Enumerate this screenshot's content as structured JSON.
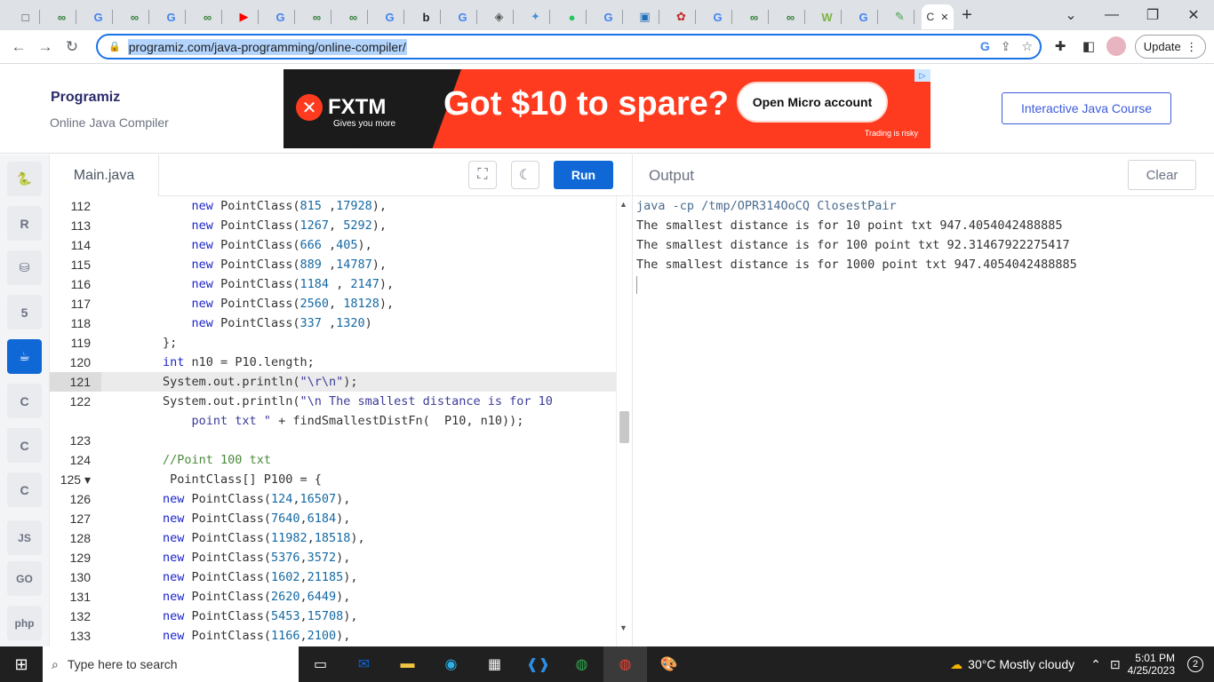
{
  "browser": {
    "tabs": [
      {
        "icon": "□",
        "color": "#444"
      },
      {
        "icon": "∞",
        "color": "#2e7d32"
      },
      {
        "icon": "G",
        "color": "#4285f4"
      },
      {
        "icon": "∞",
        "color": "#2e7d32"
      },
      {
        "icon": "G",
        "color": "#4285f4"
      },
      {
        "icon": "∞",
        "color": "#2e7d32"
      },
      {
        "icon": "▶",
        "color": "#ff0000"
      },
      {
        "icon": "G",
        "color": "#4285f4"
      },
      {
        "icon": "∞",
        "color": "#2e7d32"
      },
      {
        "icon": "∞",
        "color": "#2e7d32"
      },
      {
        "icon": "G",
        "color": "#4285f4"
      },
      {
        "icon": "b",
        "color": "#222"
      },
      {
        "icon": "G",
        "color": "#4285f4"
      },
      {
        "icon": "◈",
        "color": "#555"
      },
      {
        "icon": "✦",
        "color": "#4a90d9"
      },
      {
        "icon": "●",
        "color": "#22c55e"
      },
      {
        "icon": "G",
        "color": "#4285f4"
      },
      {
        "icon": "▣",
        "color": "#1e6fb8"
      },
      {
        "icon": "✿",
        "color": "#c62828"
      },
      {
        "icon": "G",
        "color": "#4285f4"
      },
      {
        "icon": "∞",
        "color": "#2e7d32"
      },
      {
        "icon": "∞",
        "color": "#2e7d32"
      },
      {
        "icon": "W",
        "color": "#7cb342"
      },
      {
        "icon": "G",
        "color": "#4285f4"
      },
      {
        "icon": "✎",
        "color": "#43a047"
      }
    ],
    "active_tab_letter": "C",
    "url": "programiz.com/java-programming/online-compiler/",
    "update_label": "Update"
  },
  "site": {
    "logo": "Programiz",
    "subtitle": "Online Java Compiler",
    "course_button": "Interactive Java Course"
  },
  "ad": {
    "brand": "FXTM",
    "tagline": "Gives you more",
    "headline": "Got $10 to spare?",
    "button": "Open Micro account",
    "note": "Trading is risky"
  },
  "sidebar": {
    "items": [
      "py",
      "R",
      "db",
      "5",
      "java",
      "C",
      "C++",
      "C#",
      "JS",
      "GO",
      "php"
    ]
  },
  "editor": {
    "file_tab": "Main.java",
    "run_label": "Run",
    "lines": [
      {
        "n": "112",
        "code": [
          [
            "",
            "            "
          ],
          [
            "kw",
            "new"
          ],
          [
            "",
            " PointClass("
          ],
          [
            "num",
            "815"
          ],
          [
            "",
            " ,"
          ],
          [
            "num",
            "17928"
          ],
          [
            "",
            "),"
          ]
        ]
      },
      {
        "n": "113",
        "code": [
          [
            "",
            "            "
          ],
          [
            "kw",
            "new"
          ],
          [
            "",
            " PointClass("
          ],
          [
            "num",
            "1267"
          ],
          [
            "",
            ", "
          ],
          [
            "num",
            "5292"
          ],
          [
            "",
            "),"
          ]
        ]
      },
      {
        "n": "114",
        "code": [
          [
            "",
            "            "
          ],
          [
            "kw",
            "new"
          ],
          [
            "",
            " PointClass("
          ],
          [
            "num",
            "666"
          ],
          [
            "",
            " ,"
          ],
          [
            "num",
            "405"
          ],
          [
            "",
            "),"
          ]
        ]
      },
      {
        "n": "115",
        "code": [
          [
            "",
            "            "
          ],
          [
            "kw",
            "new"
          ],
          [
            "",
            " PointClass("
          ],
          [
            "num",
            "889"
          ],
          [
            "",
            " ,"
          ],
          [
            "num",
            "14787"
          ],
          [
            "",
            "),"
          ]
        ]
      },
      {
        "n": "116",
        "code": [
          [
            "",
            "            "
          ],
          [
            "kw",
            "new"
          ],
          [
            "",
            " PointClass("
          ],
          [
            "num",
            "1184"
          ],
          [
            "",
            " , "
          ],
          [
            "num",
            "2147"
          ],
          [
            "",
            "),"
          ]
        ]
      },
      {
        "n": "117",
        "code": [
          [
            "",
            "            "
          ],
          [
            "kw",
            "new"
          ],
          [
            "",
            " PointClass("
          ],
          [
            "num",
            "2560"
          ],
          [
            "",
            ", "
          ],
          [
            "num",
            "18128"
          ],
          [
            "",
            "),"
          ]
        ]
      },
      {
        "n": "118",
        "code": [
          [
            "",
            "            "
          ],
          [
            "kw",
            "new"
          ],
          [
            "",
            " PointClass("
          ],
          [
            "num",
            "337"
          ],
          [
            "",
            " ,"
          ],
          [
            "num",
            "1320"
          ],
          [
            "",
            ")"
          ]
        ]
      },
      {
        "n": "119",
        "code": [
          [
            "",
            "        };"
          ]
        ]
      },
      {
        "n": "120",
        "code": [
          [
            "",
            "        "
          ],
          [
            "kw",
            "int"
          ],
          [
            "",
            " n10 = P10.length;"
          ]
        ]
      },
      {
        "n": "121",
        "code": [
          [
            "",
            "        System.out.println("
          ],
          [
            "str",
            "\"\\r\\n\""
          ],
          [
            "",
            ");"
          ]
        ]
      },
      {
        "n": "122",
        "code": [
          [
            "",
            "        System.out.println("
          ],
          [
            "str",
            "\"\\n The smallest distance is for 10"
          ]
        ]
      },
      {
        "n": "",
        "code": [
          [
            "str",
            "            point txt \""
          ],
          [
            "",
            " + findSmallestDistFn(  P10, n10));"
          ]
        ]
      },
      {
        "n": "123",
        "code": [
          [
            "",
            ""
          ]
        ]
      },
      {
        "n": "124",
        "code": [
          [
            "",
            "        "
          ],
          [
            "cmt",
            "//Point 100 txt"
          ]
        ]
      },
      {
        "n": "125 ▾",
        "code": [
          [
            "",
            "         PointClass[] P100 = {"
          ]
        ]
      },
      {
        "n": "126",
        "code": [
          [
            "",
            "        "
          ],
          [
            "kw",
            "new"
          ],
          [
            "",
            " PointClass("
          ],
          [
            "num",
            "124"
          ],
          [
            "",
            ","
          ],
          [
            "num",
            "16507"
          ],
          [
            "",
            "),"
          ]
        ]
      },
      {
        "n": "127",
        "code": [
          [
            "",
            "        "
          ],
          [
            "kw",
            "new"
          ],
          [
            "",
            " PointClass("
          ],
          [
            "num",
            "7640"
          ],
          [
            "",
            ","
          ],
          [
            "num",
            "6184"
          ],
          [
            "",
            "),"
          ]
        ]
      },
      {
        "n": "128",
        "code": [
          [
            "",
            "        "
          ],
          [
            "kw",
            "new"
          ],
          [
            "",
            " PointClass("
          ],
          [
            "num",
            "11982"
          ],
          [
            "",
            ","
          ],
          [
            "num",
            "18518"
          ],
          [
            "",
            "),"
          ]
        ]
      },
      {
        "n": "129",
        "code": [
          [
            "",
            "        "
          ],
          [
            "kw",
            "new"
          ],
          [
            "",
            " PointClass("
          ],
          [
            "num",
            "5376"
          ],
          [
            "",
            ","
          ],
          [
            "num",
            "3572"
          ],
          [
            "",
            "),"
          ]
        ]
      },
      {
        "n": "130",
        "code": [
          [
            "",
            "        "
          ],
          [
            "kw",
            "new"
          ],
          [
            "",
            " PointClass("
          ],
          [
            "num",
            "1602"
          ],
          [
            "",
            ","
          ],
          [
            "num",
            "21185"
          ],
          [
            "",
            "),"
          ]
        ]
      },
      {
        "n": "131",
        "code": [
          [
            "",
            "        "
          ],
          [
            "kw",
            "new"
          ],
          [
            "",
            " PointClass("
          ],
          [
            "num",
            "2620"
          ],
          [
            "",
            ","
          ],
          [
            "num",
            "6449"
          ],
          [
            "",
            "),"
          ]
        ]
      },
      {
        "n": "132",
        "code": [
          [
            "",
            "        "
          ],
          [
            "kw",
            "new"
          ],
          [
            "",
            " PointClass("
          ],
          [
            "num",
            "5453"
          ],
          [
            "",
            ","
          ],
          [
            "num",
            "15708"
          ],
          [
            "",
            "),"
          ]
        ]
      },
      {
        "n": "133",
        "code": [
          [
            "",
            "        "
          ],
          [
            "kw",
            "new"
          ],
          [
            "",
            " PointClass("
          ],
          [
            "num",
            "1166"
          ],
          [
            "",
            ","
          ],
          [
            "num",
            "2100"
          ],
          [
            "",
            "),"
          ]
        ]
      }
    ],
    "highlighted_line": "121"
  },
  "output": {
    "title": "Output",
    "clear_label": "Clear",
    "lines": [
      "java -cp /tmp/OPR314OoCQ ClosestPair",
      "The smallest distance is for 10 point txt 947.4054042488885",
      "The smallest distance is for 100 point txt 92.31467922275417",
      "The smallest distance is for 1000 point txt 947.4054042488885"
    ]
  },
  "taskbar": {
    "search_placeholder": "Type here to search",
    "weather": "30°C  Mostly cloudy",
    "time": "5:01 PM",
    "date": "4/25/2023",
    "notifications": "2"
  }
}
